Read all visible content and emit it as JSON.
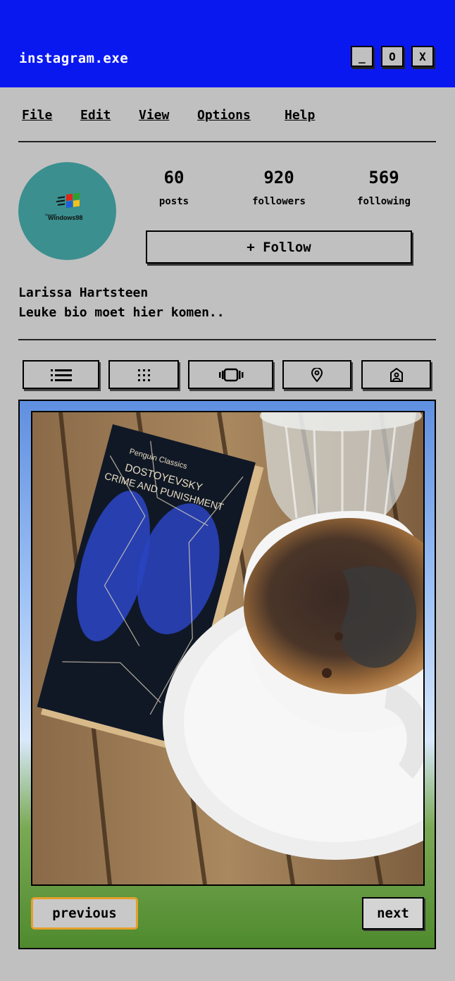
{
  "window": {
    "title": "instagram.exe",
    "minimize": "_",
    "maximize": "O",
    "close": "X"
  },
  "menu": [
    "File",
    "Edit",
    "View",
    "Options",
    "Help"
  ],
  "profile": {
    "avatar_logo_microsoft": "Microsoft",
    "avatar_logo_text": "Windows98",
    "stats": [
      {
        "value": "60",
        "label": "posts"
      },
      {
        "value": "920",
        "label": "followers"
      },
      {
        "value": "569",
        "label": "following"
      }
    ],
    "follow_label": "+ Follow",
    "name": "Larissa Hartsteen",
    "bio": "Leuke bio moet hier komen.."
  },
  "tabs": [
    {
      "icon": "list-icon"
    },
    {
      "icon": "grid-icon"
    },
    {
      "icon": "reels-icon"
    },
    {
      "icon": "location-icon"
    },
    {
      "icon": "tagged-icon"
    }
  ],
  "post": {
    "book_publisher": "Penguin Classics",
    "book_author": "DOSTOYEVSKY",
    "book_title": "CRIME AND PUNISHMENT",
    "previous_label": "previous",
    "next_label": "next"
  },
  "colors": {
    "titlebar": "#0a18f0",
    "background": "#c0c0c0",
    "avatar": "#3b8f8f",
    "previous_border": "#e4a02c"
  }
}
